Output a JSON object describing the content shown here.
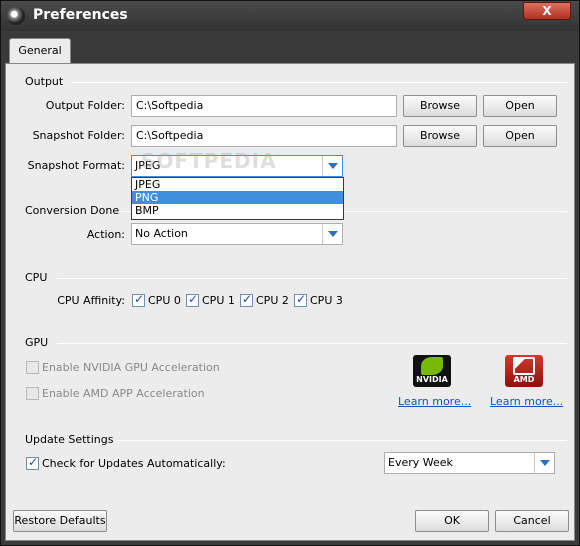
{
  "window": {
    "title": "Preferences",
    "close": "X"
  },
  "tabs": [
    "General"
  ],
  "output": {
    "section": "Output",
    "output_folder_label": "Output Folder:",
    "output_folder_value": "C:\\Softpedia",
    "snapshot_folder_label": "Snapshot Folder:",
    "snapshot_folder_value": "C:\\Softpedia",
    "browse": "Browse",
    "open": "Open",
    "snapshot_format_label": "Snapshot Format:",
    "snapshot_format_value": "JPEG",
    "snapshot_format_options": [
      "JPEG",
      "PNG",
      "BMP"
    ],
    "watermark": "SOFTPEDIA"
  },
  "conversion": {
    "section": "Conversion Done",
    "action_label": "Action:",
    "action_value": "No Action"
  },
  "cpu": {
    "section": "CPU",
    "affinity_label": "CPU Affinity:",
    "cores": [
      {
        "label": "CPU 0",
        "checked": true
      },
      {
        "label": "CPU 1",
        "checked": true
      },
      {
        "label": "CPU 2",
        "checked": true
      },
      {
        "label": "CPU 3",
        "checked": true
      }
    ]
  },
  "gpu": {
    "section": "GPU",
    "nvidia_label": "Enable NVIDIA GPU Acceleration",
    "amd_label": "Enable AMD APP Acceleration",
    "nvidia_logo": "NVIDIA",
    "amd_logo": "AMD",
    "learn_more": "Learn more..."
  },
  "update": {
    "section": "Update Settings",
    "check_label": "Check for Updates Automatically:",
    "checked": true,
    "frequency_value": "Every Week"
  },
  "footer": {
    "restore": "Restore Defaults",
    "ok": "OK",
    "cancel": "Cancel"
  },
  "colors": {
    "accent": "#3f8fde",
    "link": "#1a4fbf",
    "title_bar": "#3a3a3a"
  }
}
